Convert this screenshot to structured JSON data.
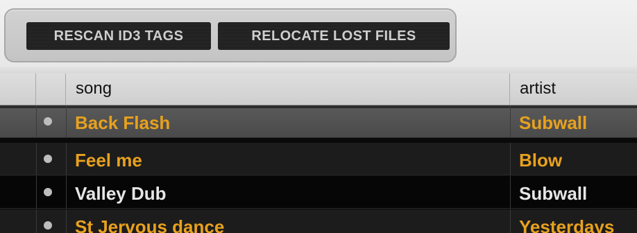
{
  "toolbar": {
    "rescan_label": "RESCAN ID3 TAGS",
    "relocate_label": "RELOCATE LOST FILES"
  },
  "columns": {
    "song": "song",
    "artist": "artist"
  },
  "tracks": [
    {
      "song": "Back Flash",
      "artist": "Subwall",
      "color": "#e8a11e"
    },
    {
      "song": "Feel me",
      "artist": "Blow",
      "color": "#e8a11e"
    },
    {
      "song": "Valley Dub",
      "artist": "Subwall",
      "color": "#e6e6e6"
    },
    {
      "song": "St Jervous dance",
      "artist": "Yesterdays",
      "color": "#e8a11e"
    }
  ],
  "colors": {
    "highlight_text": "#e8a11e",
    "normal_text": "#e6e6e6",
    "status_dot": "#bdbdbd",
    "selected_row": "#505050"
  },
  "icons": {
    "status": "status-dot-icon"
  }
}
